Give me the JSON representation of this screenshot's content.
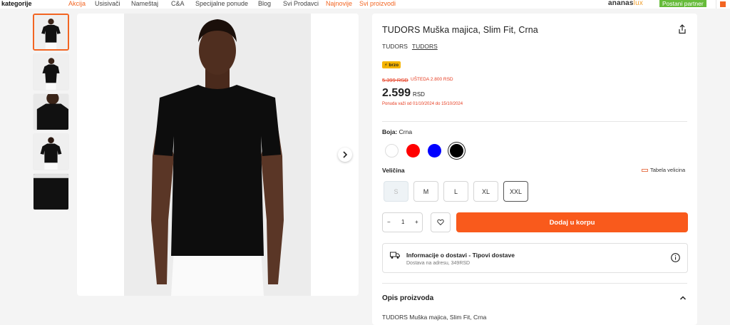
{
  "nav": {
    "categories": "kategorije",
    "items": [
      {
        "label": "Akcija",
        "highlight": true
      },
      {
        "label": "Usisivači",
        "highlight": false
      },
      {
        "label": "Nameštaj",
        "highlight": false
      },
      {
        "label": "C&A",
        "highlight": false
      },
      {
        "label": "Specijalne ponude",
        "highlight": false
      },
      {
        "label": "Blog",
        "highlight": false
      },
      {
        "label": "Svi Prodavci",
        "highlight": false
      },
      {
        "label": "Najnovije",
        "highlight": true
      },
      {
        "label": "Svi proizvodi",
        "highlight": true
      }
    ],
    "logo": "ananas",
    "logo_suffix": "lux",
    "partner_button": "Postani partner"
  },
  "gallery": {
    "thumb_count": 5,
    "active_index": 0
  },
  "product": {
    "title": "TUDORS Muška majica, Slim Fit, Crna",
    "brand": "TUDORS",
    "brand_link": "TUDORS",
    "badge": "brzo",
    "old_price": "5.399 RSD",
    "saving": "UŠTEDA 2.800 RSD",
    "price": "2.599",
    "currency": "RSD",
    "validity": "Ponuda važi od 01/10/2024 do 15/10/2024"
  },
  "color": {
    "label": "Boja:",
    "value": "Crna",
    "swatches": [
      {
        "name": "white",
        "hex": "#ffffff"
      },
      {
        "name": "red",
        "hex": "#ff0000"
      },
      {
        "name": "blue",
        "hex": "#0000ff"
      },
      {
        "name": "black",
        "hex": "#000000",
        "selected": true
      }
    ]
  },
  "size": {
    "label": "Veličina",
    "chart_link": "Tabela velicina",
    "options": [
      {
        "label": "S",
        "state": "disabled"
      },
      {
        "label": "M",
        "state": "available"
      },
      {
        "label": "L",
        "state": "available"
      },
      {
        "label": "XL",
        "state": "available"
      },
      {
        "label": "XXL",
        "state": "selected"
      }
    ]
  },
  "cart": {
    "minus": "−",
    "quantity": "1",
    "plus": "+",
    "add_label": "Dodaj u korpu"
  },
  "delivery": {
    "title": "Informacije o dostavi - Tipovi dostave",
    "subtitle": "Dostava na adresu, 349RSD"
  },
  "description": {
    "title": "Opis proizvoda",
    "text": "TUDORS Muška majica, Slim Fit, Crna"
  },
  "colors": {
    "accent": "#f95a1c",
    "partner": "#66bb3a",
    "sale": "#e63a1e"
  }
}
